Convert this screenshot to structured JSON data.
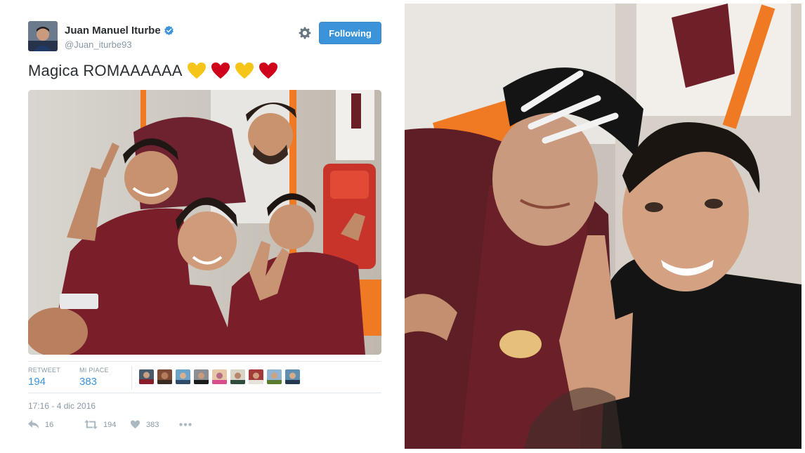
{
  "tweet": {
    "author": {
      "display_name": "Juan Manuel Iturbe",
      "handle": "@Juan_iturbe93",
      "verified": true
    },
    "follow_button_label": "Following",
    "text": "Magica ROMAAAAAA",
    "emoji": [
      "yellow-heart",
      "red-heart",
      "yellow-heart",
      "red-heart"
    ],
    "stats": {
      "retweets_label": "RETWEET",
      "retweets_value": "194",
      "likes_label": "MI PIACE",
      "likes_value": "383"
    },
    "liker_avatar_count": 9,
    "timestamp": "17:16 - 4 dic 2016",
    "actions": {
      "reply_count": "16",
      "retweet_count": "194",
      "like_count": "383"
    }
  },
  "colors": {
    "accent": "#3b94d9",
    "muted": "#8899a6",
    "text": "#292f33",
    "border": "#e1e8ed",
    "roma_maroon": "#7a1e2a",
    "heart_red": "#d0021b",
    "heart_yellow": "#f5c518"
  },
  "icons": {
    "verified": "verified-badge-icon",
    "settings": "gear-icon",
    "reply": "reply-icon",
    "retweet": "retweet-icon",
    "like": "heart-icon",
    "more": "more-dots-icon"
  }
}
